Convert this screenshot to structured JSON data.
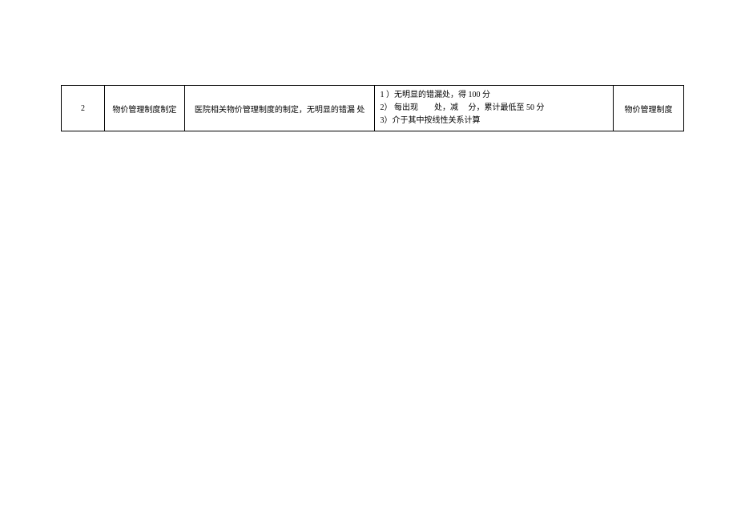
{
  "table": {
    "rows": [
      {
        "num": "2",
        "name": "物价管理制度制定",
        "desc": "医院相关物价管理制度的制定，无明显的错漏 处",
        "scoring_line1": "1 ）无明显的错漏处，得 100 分",
        "scoring_line2": "2） 每出现　　处，减　 分，累计最低至 50 分",
        "scoring_line3": "3）介于其中按线性关系计算",
        "last": "物价管理制度"
      }
    ]
  }
}
